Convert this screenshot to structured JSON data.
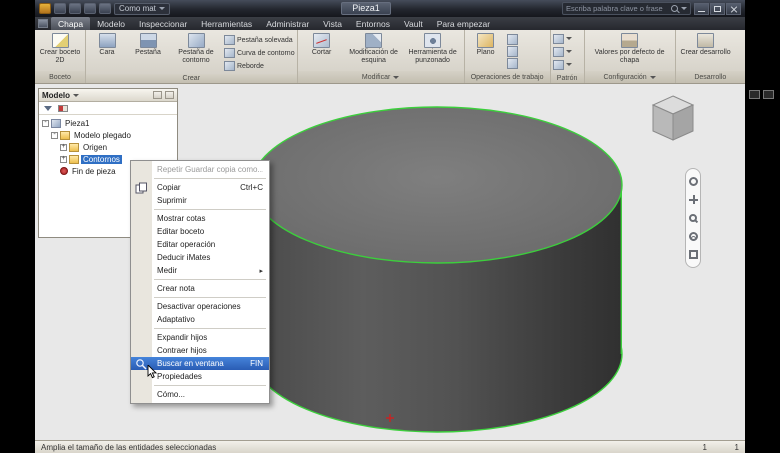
{
  "colors": {
    "selection_highlight_green": "#3ccf3c",
    "selection_blue": "#2f6fc4",
    "titlebar_bg": "#23262e"
  },
  "titlebar": {
    "material_dropdown": "Como mat",
    "document_title": "Pieza1",
    "search_placeholder": "Escriba palabra clave o frase"
  },
  "tabs": [
    {
      "label": "Chapa"
    },
    {
      "label": "Modelo"
    },
    {
      "label": "Inspeccionar"
    },
    {
      "label": "Herramientas"
    },
    {
      "label": "Administrar"
    },
    {
      "label": "Vista"
    },
    {
      "label": "Entornos"
    },
    {
      "label": "Vault"
    },
    {
      "label": "Para empezar"
    }
  ],
  "ribbon": {
    "boceto": {
      "label": "Boceto",
      "create_sketch": "Crear boceto 2D"
    },
    "crear": {
      "label": "Crear",
      "cara": "Cara",
      "pestana": "Pestaña",
      "pestana_contorno": "Pestaña de contorno",
      "pestana_solevada": "Pestaña solevada",
      "curva_contorno": "Curva de contorno",
      "reborde": "Reborde"
    },
    "modificar": {
      "label": "Modificar",
      "cortar": "Cortar",
      "mod_esquina": "Modificación de esquina",
      "punzonado": "Herramienta de punzonado"
    },
    "operaciones": {
      "label": "Operaciones de trabajo",
      "plano": "Plano"
    },
    "patron": {
      "label": "Patrón"
    },
    "configuracion": {
      "label": "Configuración",
      "valores": "Valores por defecto de chapa"
    },
    "desarrollo": {
      "label": "Desarrollo",
      "crear_desarrollo": "Crear desarrollo"
    }
  },
  "browser": {
    "title": "Modelo",
    "tree": [
      {
        "label": "Pieza1"
      },
      {
        "label": "Modelo plegado"
      },
      {
        "label": "Origen"
      },
      {
        "label": "Contornos",
        "selected": true
      },
      {
        "label": "Fin de pieza"
      }
    ]
  },
  "context_menu": {
    "items": [
      {
        "label": "Repetir Guardar copia como...",
        "state": "disabled"
      },
      {
        "label": "Copiar",
        "shortcut": "Ctrl+C"
      },
      {
        "label": "Suprimir"
      },
      {
        "label": "Mostrar cotas"
      },
      {
        "label": "Editar boceto"
      },
      {
        "label": "Editar operación"
      },
      {
        "label": "Deducir iMates"
      },
      {
        "label": "Medir",
        "submenu": "▸"
      },
      {
        "label": "Crear nota"
      },
      {
        "label": "Desactivar operaciones"
      },
      {
        "label": "Adaptativo"
      },
      {
        "label": "Expandir hijos"
      },
      {
        "label": "Contraer hijos"
      },
      {
        "label": "Buscar en ventana",
        "shortcut": "FIN",
        "state": "highlighted"
      },
      {
        "label": "Propiedades"
      },
      {
        "label": "Cómo..."
      }
    ]
  },
  "statusbar": {
    "message": "Amplia el tamaño de las entidades seleccionadas",
    "count_1": "1",
    "count_2": "1"
  }
}
